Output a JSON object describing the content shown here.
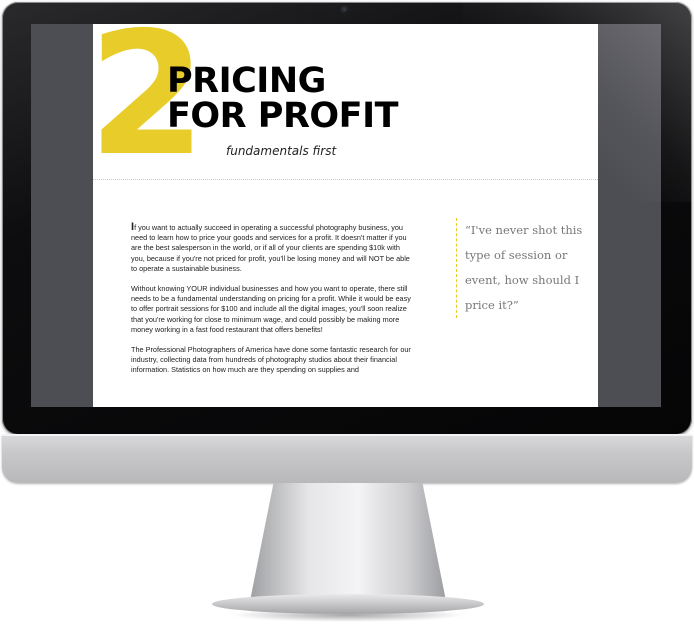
{
  "document": {
    "chapter_number": "2",
    "title_line1": "PRICING",
    "title_line2": "FOR PROFIT",
    "subtitle": "fundamentals first",
    "drop_cap": "I",
    "paragraph1_rest": "f you want to actually succeed in operating a successful photography business, you need to learn how to price your goods and services for a profit.  It doesn't matter if you are the best salesperson in the world, or if all of your clients are spending $10k with you, because if you're not priced for profit, you'll be losing money and will NOT be able to operate a sustainable business.",
    "paragraph2": "Without knowing YOUR individual businesses and how you want to operate, there still needs to be a fundamental understanding on pricing for a profit.  While it would be easy to offer portrait sessions for $100 and include all the digital images, you'll soon realize that you're working for close to minimum wage, and could possibly be making more money working in a fast food restaurant that offers benefits!",
    "paragraph3": "The Professional Photographers of America have done some fantastic research for our industry, collecting data from hundreds of photography studios about their financial information.  Statistics on how much are they spending on supplies and",
    "pull_quote": "“I've never shot this type of session or event, how should I price it?”"
  },
  "colors": {
    "accent": "#e8cd2a",
    "screen_bg": "#4d4d54",
    "page_bg": "#ffffff"
  }
}
